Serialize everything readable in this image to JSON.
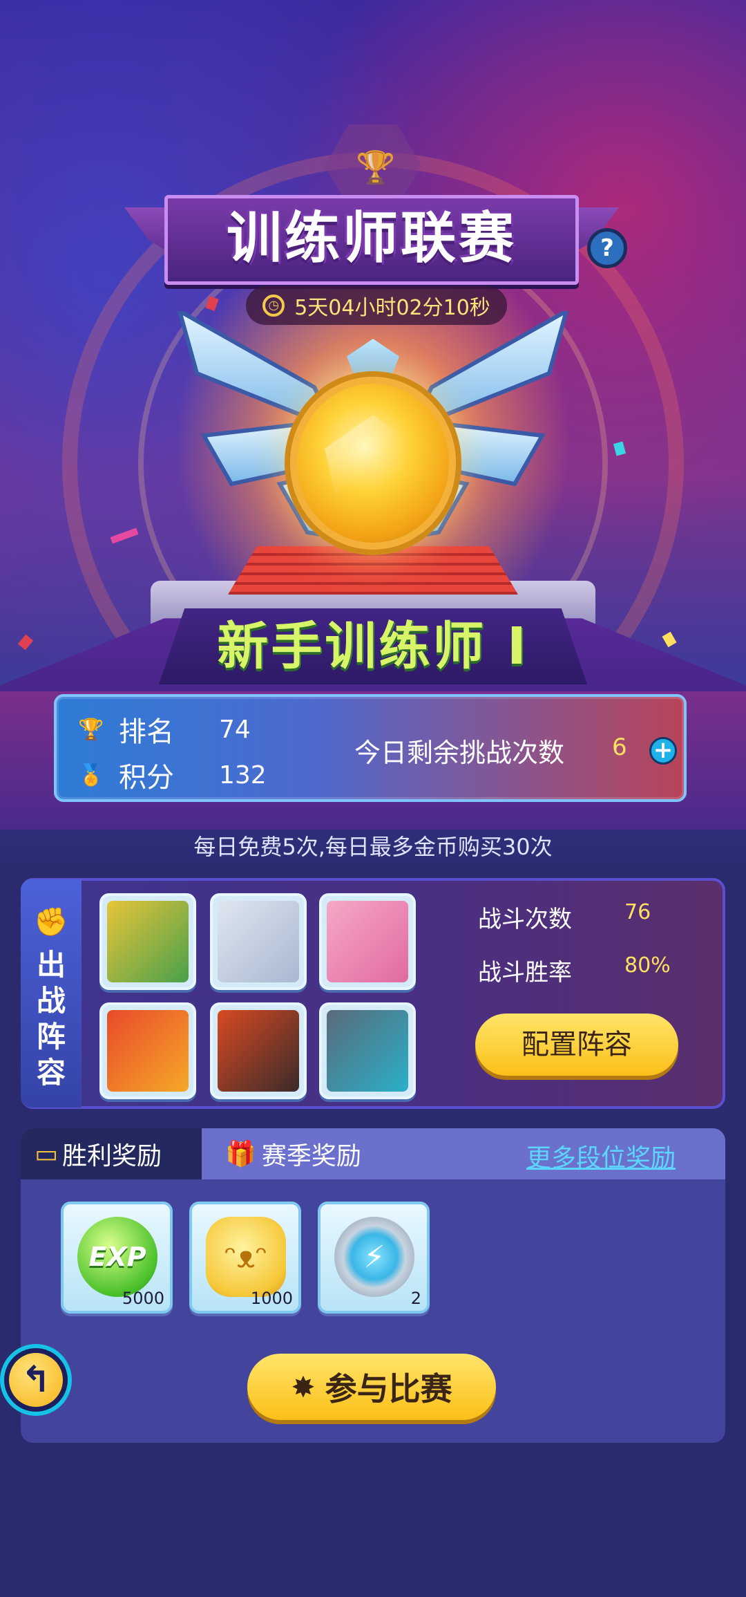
{
  "header": {
    "title": "训练师联赛",
    "help_label": "?",
    "countdown": "5天04小时02分10秒"
  },
  "rank": {
    "tier_name": "新手训练师 I"
  },
  "stats": {
    "ranking_label": "排名",
    "ranking_value": "74",
    "score_label": "积分",
    "score_value": "132",
    "challenges_label": "今日剩余挑战次数",
    "challenges_value": "6",
    "add_label": "+",
    "note": "每日免费5次,每日最多金币购买30次"
  },
  "lineup": {
    "title": "出战阵容",
    "battle_count_label": "战斗次数",
    "battle_count_value": "76",
    "win_rate_label": "战斗胜率",
    "win_rate_value": "80%",
    "config_button": "配置阵容"
  },
  "rewards": {
    "tabs": [
      {
        "label": "胜利奖励",
        "icon": "chest-icon"
      },
      {
        "label": "赛季奖励",
        "icon": "gift-icon"
      }
    ],
    "more_link": "更多段位奖励",
    "items": [
      {
        "name": "exp",
        "icon": "exp-orb-icon",
        "count": "5000",
        "art_text": "EXP"
      },
      {
        "name": "cat-coin",
        "icon": "cat-coin-icon",
        "count": "1000"
      },
      {
        "name": "energy-badge",
        "icon": "energy-badge-icon",
        "count": "2"
      }
    ],
    "join_button": "参与比赛"
  },
  "colors": {
    "accent_yellow": "#fbbf18",
    "tier_green": "#d8f56a",
    "link_cyan": "#5cd6ff",
    "panel_blue": "#43449c"
  }
}
